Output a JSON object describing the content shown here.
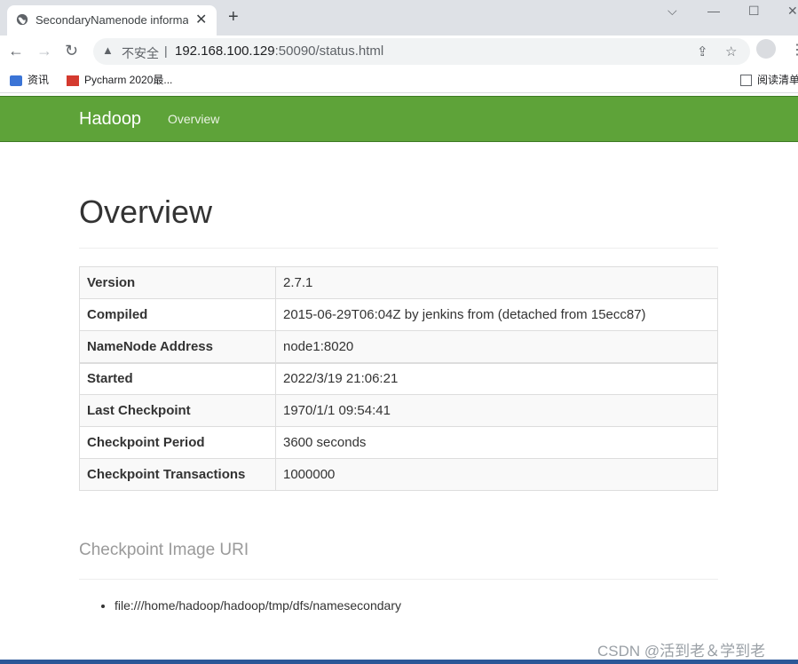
{
  "browser": {
    "tab_title": "SecondaryNamenode informa",
    "tab_close": "✕",
    "new_tab": "+",
    "window_controls": [
      "⌵",
      "—",
      "☐",
      "✕"
    ],
    "insecure_label": "不安全",
    "separator": "|",
    "url_host": "192.168.100.129",
    "url_rest": ":50090/status.html",
    "bookmarks": [
      {
        "label": "资讯"
      },
      {
        "label": "Pycharm 2020最..."
      },
      {
        "label": "阅读清单"
      }
    ]
  },
  "navbar": {
    "brand": "Hadoop",
    "link": "Overview",
    "color": "#5ea339"
  },
  "overview": {
    "title": "Overview",
    "rows": [
      {
        "key": "Version",
        "value": "2.7.1"
      },
      {
        "key": "Compiled",
        "value": "2015-06-29T06:04Z by jenkins from (detached from 15ecc87)"
      },
      {
        "key": "NameNode Address",
        "value": "node1:8020"
      },
      {
        "key": "Started",
        "value": "2022/3/19 21:06:21"
      },
      {
        "key": "Last Checkpoint",
        "value": "1970/1/1 09:54:41"
      },
      {
        "key": "Checkpoint Period",
        "value": "3600 seconds"
      },
      {
        "key": "Checkpoint Transactions",
        "value": "1000000"
      }
    ]
  },
  "checkpoint": {
    "title": "Checkpoint Image URI",
    "uris": [
      "file:///home/hadoop/hadoop/tmp/dfs/namesecondary"
    ]
  },
  "watermark": "CSDN @活到老＆学到老"
}
